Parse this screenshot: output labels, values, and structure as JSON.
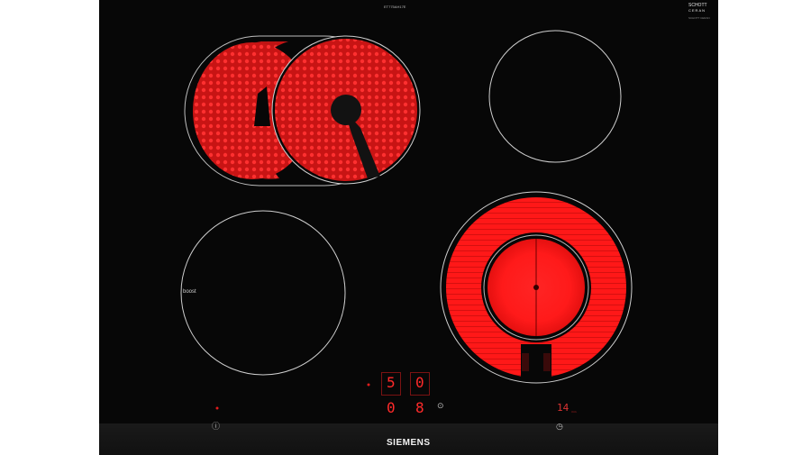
{
  "hob": {
    "model_label": "ET775AH17E",
    "certification_top": "SCHOTT",
    "certification_bottom": "CERAN",
    "certification_small": "SCHOTT CERAN",
    "brand": "SIEMENS",
    "boost_label": "boost",
    "display_left_top": "5",
    "display_right_top": "0",
    "display_left_bottom": "0",
    "display_right_bottom": "8",
    "timer_value": "14",
    "timer_unit": "min",
    "colors": {
      "glass": "#070707",
      "heat": "#ff1a1a",
      "ring": "#cfcfcf",
      "display": "#ff2a2a"
    },
    "icons": [
      "power-icon",
      "lock-icon",
      "timer-icon"
    ]
  }
}
